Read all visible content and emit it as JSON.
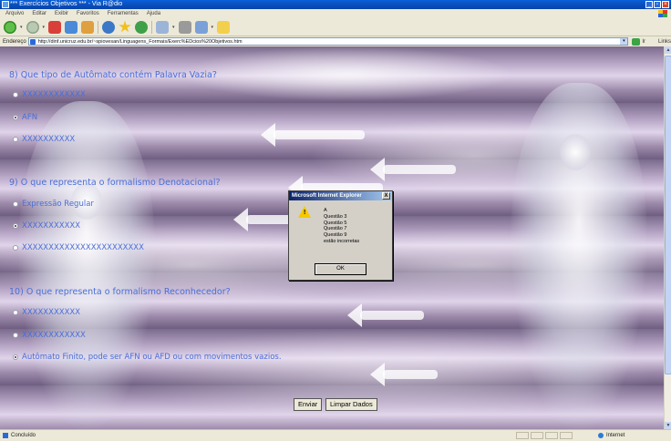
{
  "window": {
    "title": "*** Exercícios Objetivos *** - Via R@dio"
  },
  "menu": [
    "Arquivo",
    "Editar",
    "Exibir",
    "Favoritos",
    "Ferramentas",
    "Ajuda"
  ],
  "address": {
    "label": "Endereço",
    "url": "http://dinf.unicruz.edu.br/~spiovesan/Linguagens_Formais/Exerc%EDcios%20Objetivos.htm",
    "go_label": "Ir",
    "links_label": "Links"
  },
  "questions": [
    {
      "text": "8) Que tipo de Autômato contém Palavra Vazia?",
      "options": [
        {
          "label": "XXXXXXXXXXXX",
          "checked": false
        },
        {
          "label": "AFN",
          "checked": true
        },
        {
          "label": "XXXXXXXXXX",
          "checked": false
        }
      ]
    },
    {
      "text": "9) O que representa o formalismo Denotacional?",
      "options": [
        {
          "label": "Expressão Regular",
          "checked": false
        },
        {
          "label": "XXXXXXXXXXX",
          "checked": true
        },
        {
          "label": "XXXXXXXXXXXXXXXXXXXXXXX",
          "checked": false
        }
      ]
    },
    {
      "text": "10) O que representa o formalismo Reconhecedor?",
      "options": [
        {
          "label": "XXXXXXXXXXX",
          "checked": false
        },
        {
          "label": "XXXXXXXXXXXX",
          "checked": false
        },
        {
          "label": "Autômato Finito, pode ser AFN ou AFD ou com movimentos vazios.",
          "checked": true
        }
      ]
    }
  ],
  "form": {
    "submit_label": "Enviar",
    "reset_label": "Limpar Dados"
  },
  "dialog": {
    "title": "Microsoft Internet Explorer",
    "close": "X",
    "icon": "warning-icon",
    "lines": [
      "A",
      "Questão 3",
      "Questão 5",
      "Questão 7",
      "Questão 9",
      "estão incorretas"
    ],
    "ok_label": "OK"
  },
  "status": {
    "text": "Concluído",
    "zone": "Internet"
  },
  "colors": {
    "question_text": "#4a6fd8",
    "titlebar": "#0a5fd8",
    "dialog_title": "#0a246a"
  }
}
